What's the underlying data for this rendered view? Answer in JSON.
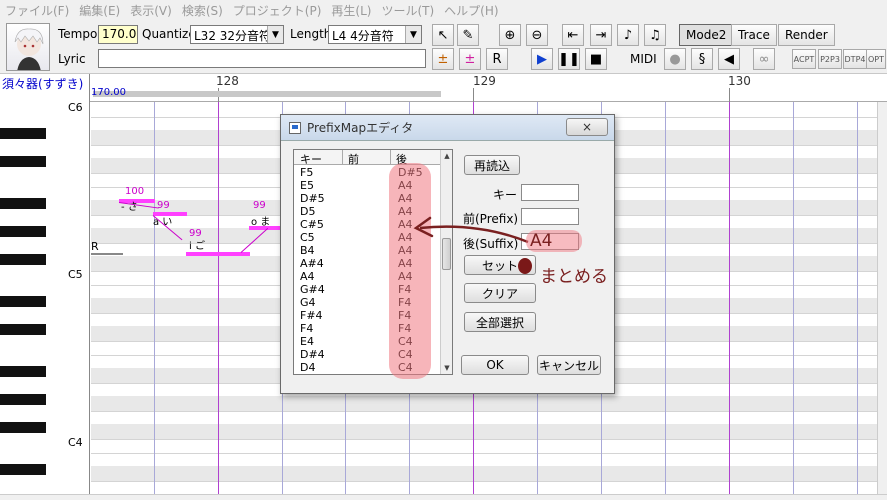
{
  "menu": [
    "ファイル(F)",
    "編集(E)",
    "表示(V)",
    "検索(S)",
    "プロジェクト(P)",
    "再生(L)",
    "ツール(T)",
    "ヘルプ(H)"
  ],
  "toolbar": {
    "tempo_label": "Tempo",
    "tempo_value": "170.0",
    "quantize_label": "Quantize",
    "quantize_value": "L32 32分音符",
    "length_label": "Length",
    "length_value": "L4  4分音符",
    "lyric_label": "Lyric",
    "lyric_value": "",
    "midi_label": "MIDI",
    "mode2_label": "Mode2",
    "trace_label": "Trace",
    "render_label": "Render",
    "small_icons": [
      "ACPT",
      "P2P3",
      "DTP4",
      "OPT"
    ]
  },
  "ruler": {
    "singer": "須々器(すずき)",
    "tempo": "170.00",
    "measures": [
      "128",
      "129",
      "130"
    ]
  },
  "roll": {
    "keys": [
      "C6",
      "C5",
      "C4"
    ],
    "notes": [
      {
        "lyric": "- さ",
        "velocity": "100"
      },
      {
        "lyric": "a い",
        "velocity": "99"
      },
      {
        "lyric": "i ご",
        "velocity": "99"
      },
      {
        "lyric": "o ま",
        "velocity": "99"
      }
    ],
    "rest_label": "R"
  },
  "dialog": {
    "title": "PrefixMapエディタ",
    "close_label": "×",
    "columns": [
      "キー",
      "前",
      "後"
    ],
    "rows": [
      {
        "key": "F5",
        "prefix": "",
        "suffix": "D#5"
      },
      {
        "key": "E5",
        "prefix": "",
        "suffix": "A4"
      },
      {
        "key": "D#5",
        "prefix": "",
        "suffix": "A4"
      },
      {
        "key": "D5",
        "prefix": "",
        "suffix": "A4"
      },
      {
        "key": "C#5",
        "prefix": "",
        "suffix": "A4"
      },
      {
        "key": "C5",
        "prefix": "",
        "suffix": "A4"
      },
      {
        "key": "B4",
        "prefix": "",
        "suffix": "A4"
      },
      {
        "key": "A#4",
        "prefix": "",
        "suffix": "A4"
      },
      {
        "key": "A4",
        "prefix": "",
        "suffix": "A4"
      },
      {
        "key": "G#4",
        "prefix": "",
        "suffix": "F4"
      },
      {
        "key": "G4",
        "prefix": "",
        "suffix": "F4"
      },
      {
        "key": "F#4",
        "prefix": "",
        "suffix": "F4"
      },
      {
        "key": "F4",
        "prefix": "",
        "suffix": "F4"
      },
      {
        "key": "E4",
        "prefix": "",
        "suffix": "C4"
      },
      {
        "key": "D#4",
        "prefix": "",
        "suffix": "C4"
      },
      {
        "key": "D4",
        "prefix": "",
        "suffix": "C4"
      }
    ],
    "reload_label": "再読込",
    "key_label": "キー",
    "prefix_label": "前(Prefix)",
    "suffix_label": "後(Suffix)",
    "set_label": "セット",
    "clear_label": "クリア",
    "select_all_label": "全部選択",
    "ok_label": "OK",
    "cancel_label": "キャンセル"
  },
  "annotations": {
    "suffix_value": "A4",
    "note": "まとめる"
  },
  "colors": {
    "highlight": "#f07882",
    "annotation": "#7a2020",
    "note": "#ff40ff",
    "bar_line": "#b040d0"
  }
}
